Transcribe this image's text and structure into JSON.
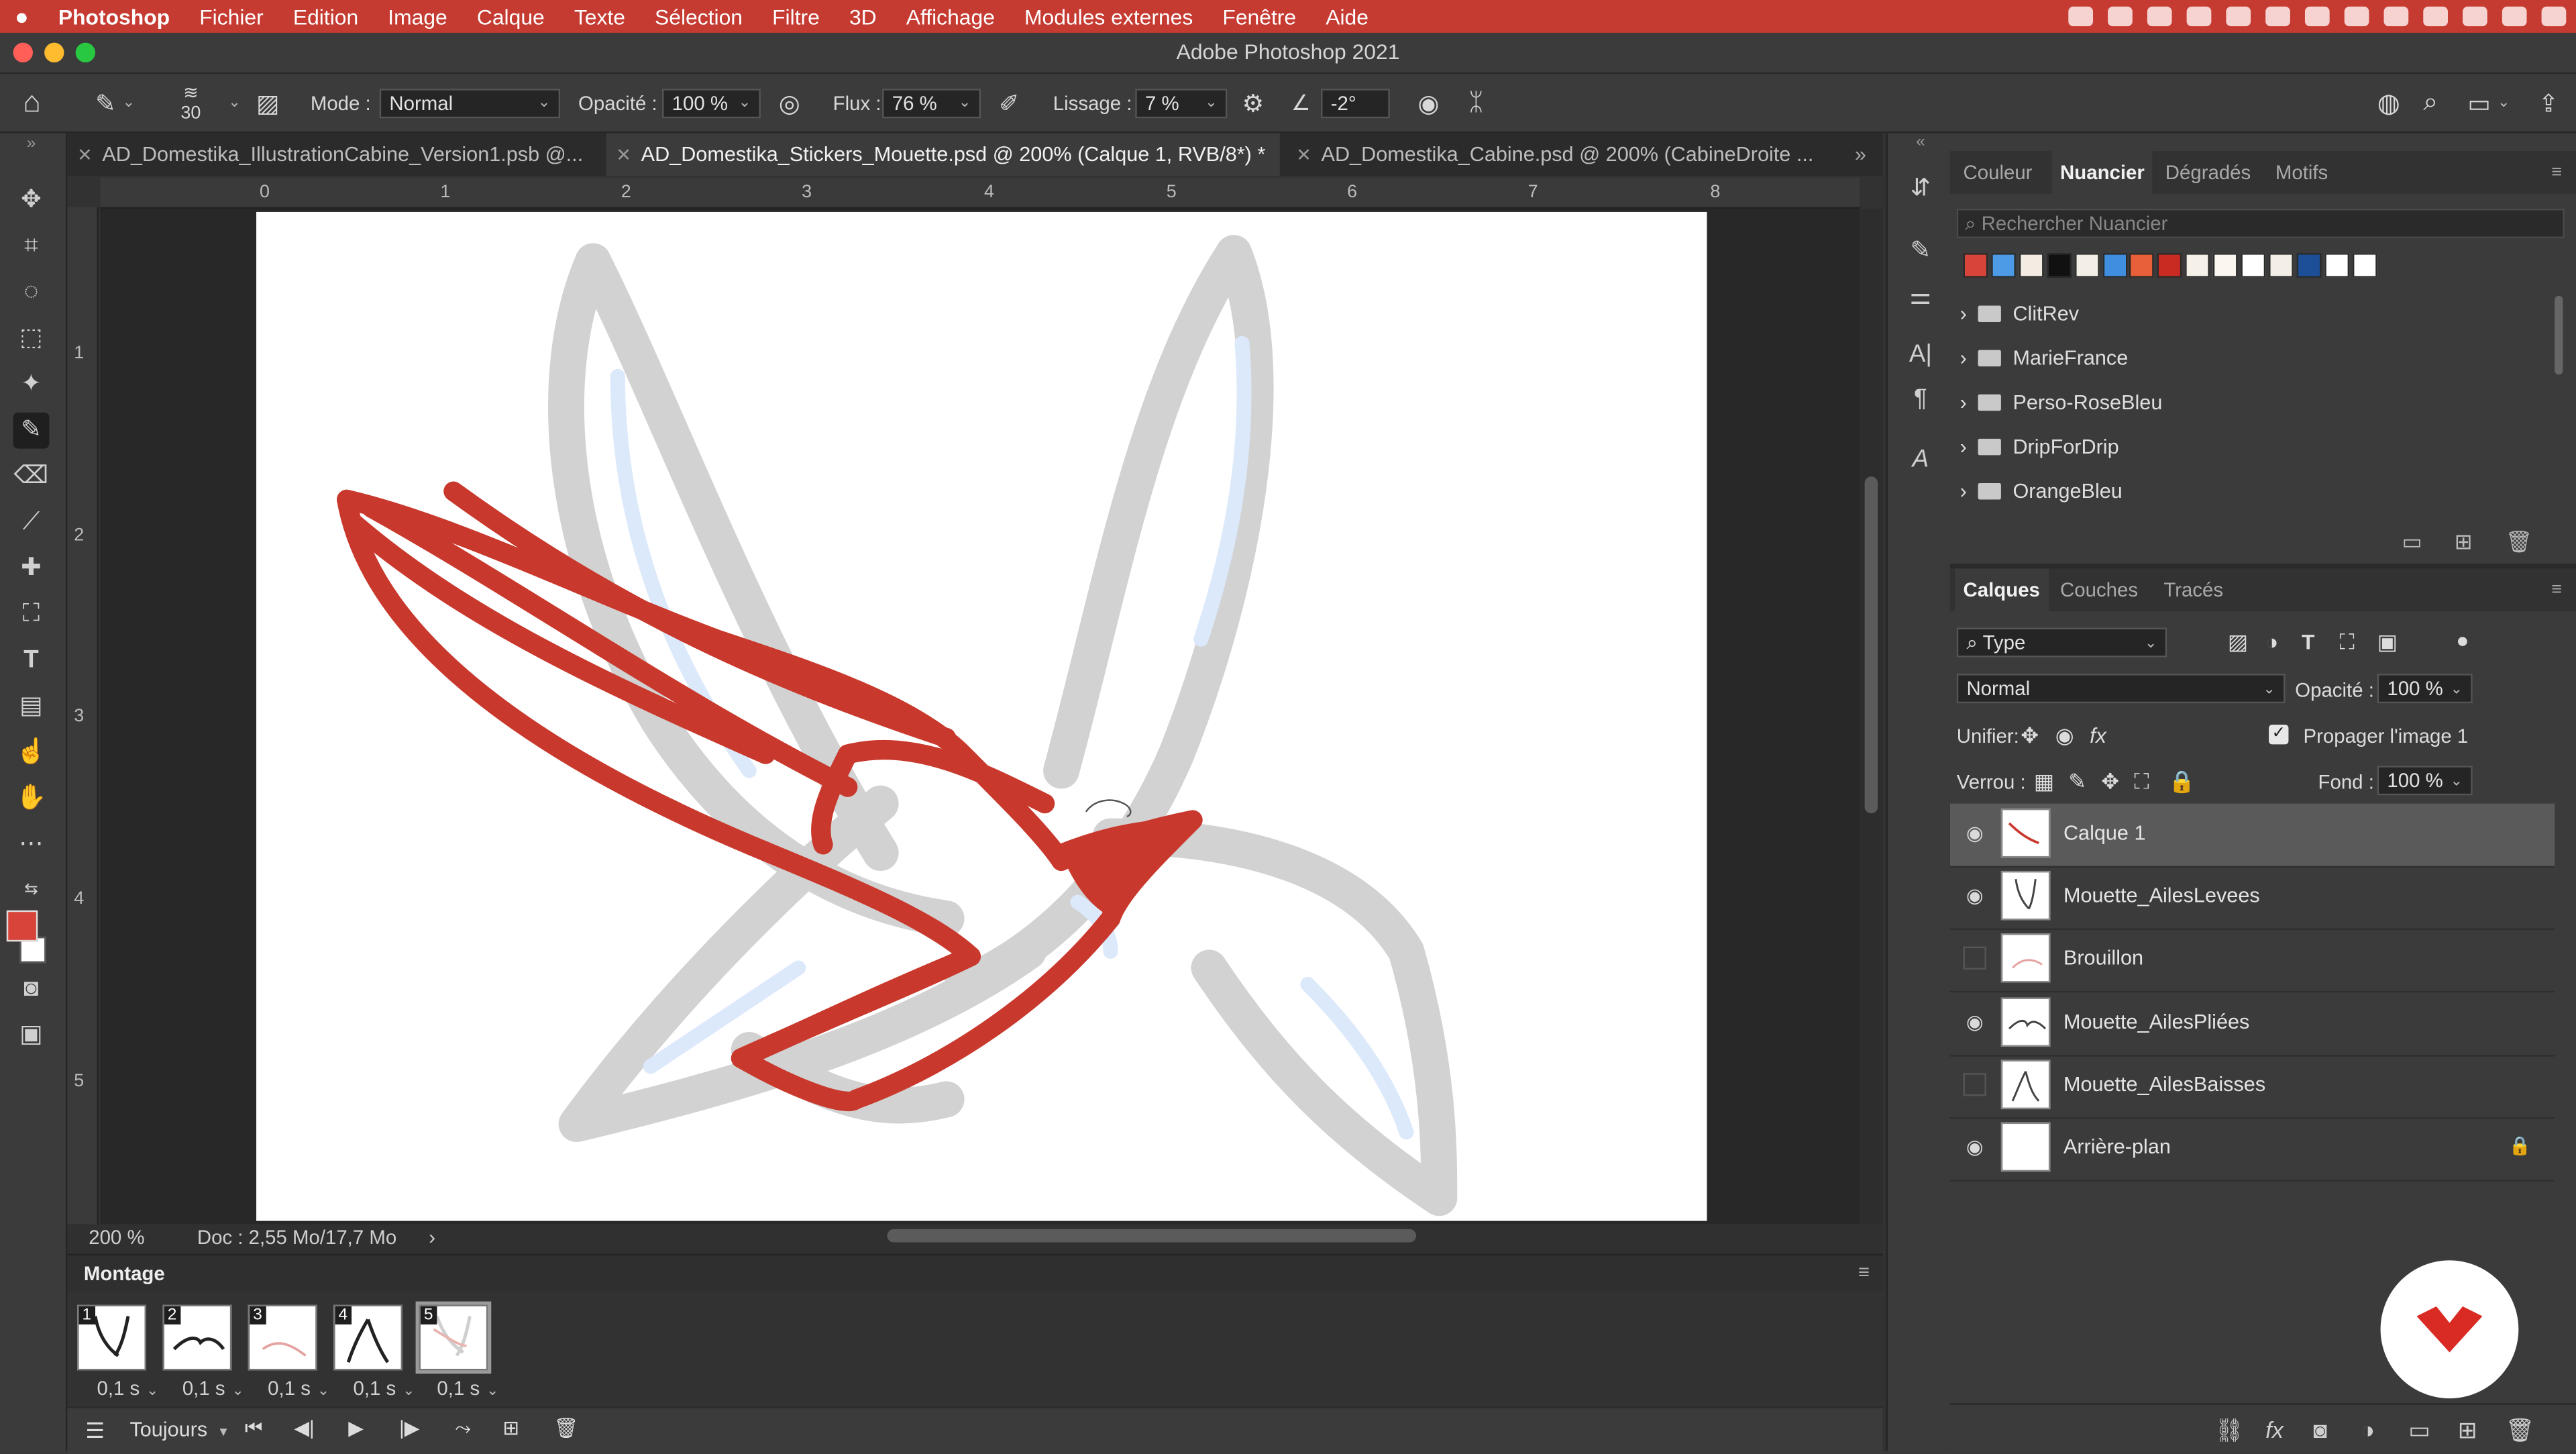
{
  "menubar": {
    "apple": "",
    "items": [
      "Photoshop",
      "Fichier",
      "Edition",
      "Image",
      "Calque",
      "Texte",
      "Sélection",
      "Filtre",
      "3D",
      "Affichage",
      "Modules externes",
      "Fenêtre",
      "Aide"
    ]
  },
  "window": {
    "title": "Adobe Photoshop 2021"
  },
  "options": {
    "brush_size": "30",
    "mode_label": "Mode :",
    "mode_value": "Normal",
    "opacity_label": "Opacité :",
    "opacity_value": "100 %",
    "flux_label": "Flux :",
    "flux_value": "76 %",
    "lissage_label": "Lissage :",
    "lissage_value": "7 %",
    "angle_value": "-2°"
  },
  "tabs": [
    {
      "label": "AD_Domestika_IllustrationCabine_Version1.psb @..."
    },
    {
      "label": "AD_Domestika_Stickers_Mouette.psd @ 200% (Calque 1, RVB/8*) *"
    },
    {
      "label": "AD_Domestika_Cabine.psd @ 200% (CabineDroite ..."
    }
  ],
  "rulers": {
    "h": [
      "0",
      "1",
      "2",
      "3",
      "4",
      "5",
      "6",
      "7",
      "8"
    ],
    "v": [
      "1",
      "2",
      "3",
      "4",
      "5"
    ]
  },
  "status": {
    "zoom": "200 %",
    "doc": "Doc : 2,55 Mo/17,7 Mo",
    "arrow": "›"
  },
  "timeline": {
    "title": "Montage",
    "frames": [
      {
        "num": "1",
        "dur": "0,1 s"
      },
      {
        "num": "2",
        "dur": "0,1 s"
      },
      {
        "num": "3",
        "dur": "0,1 s"
      },
      {
        "num": "4",
        "dur": "0,1 s"
      },
      {
        "num": "5",
        "dur": "0,1 s"
      }
    ],
    "loop": "Toujours"
  },
  "swatches_panel": {
    "tabs": [
      "Couleur",
      "Nuancier",
      "Dégradés",
      "Motifs"
    ],
    "search_placeholder": "Rechercher Nuancier",
    "colors": [
      "#d9443a",
      "#4d9be6",
      "#f2ece2",
      "#111111",
      "#f4efe6",
      "#3f8ee0",
      "#e8603a",
      "#c92a21",
      "#f6f1e8",
      "#fbf7f0",
      "#ffffff",
      "#f3efe6",
      "#1c4f98",
      "#ffffff",
      "#ffffff"
    ],
    "groups": [
      "ClitRev",
      "MarieFrance",
      "Perso-RoseBleu",
      "DripForDrip",
      "OrangeBleu"
    ]
  },
  "layers_panel": {
    "tabs": [
      "Calques",
      "Couches",
      "Tracés"
    ],
    "filter": "Type",
    "blend": "Normal",
    "opacity_label": "Opacité :",
    "opacity_value": "100 %",
    "unify_label": "Unifier:",
    "propagate_label": "Propager l'image 1",
    "lock_label": "Verrou :",
    "fill_label": "Fond :",
    "fill_value": "100 %",
    "layers": [
      {
        "name": "Calque 1",
        "visible": true,
        "selected": true
      },
      {
        "name": "Mouette_AilesLevees",
        "visible": true
      },
      {
        "name": "Brouillon",
        "visible": false
      },
      {
        "name": "Mouette_AilesPliées",
        "visible": true
      },
      {
        "name": "Mouette_AilesBaisses",
        "visible": false
      },
      {
        "name": "Arrière-plan",
        "visible": true,
        "locked": true
      }
    ]
  },
  "colors": {
    "menubar": "#c53a31",
    "foreground": "#d9443a",
    "background": "#ffffff",
    "logo": "#d92b24"
  }
}
